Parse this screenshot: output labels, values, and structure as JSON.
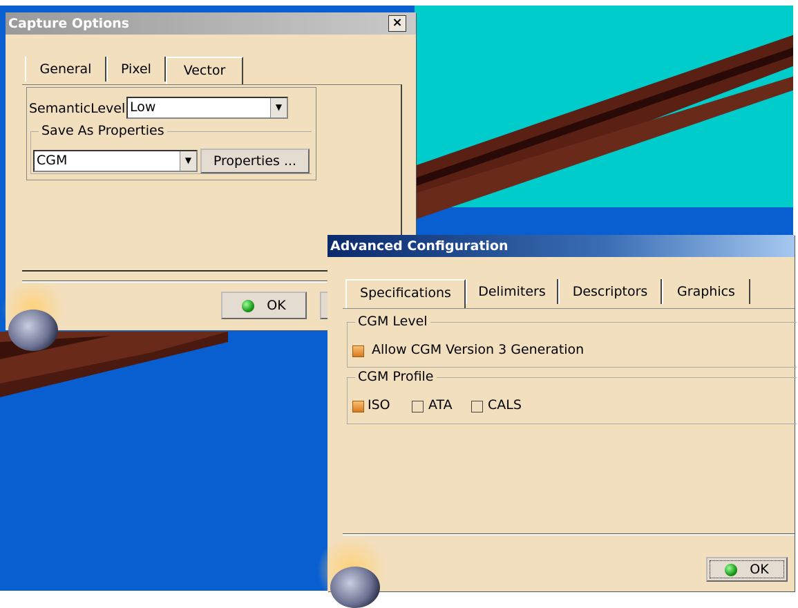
{
  "capture_dialog": {
    "title": "Capture Options",
    "close_label": "×",
    "tabs": [
      "General",
      "Pixel",
      "Vector"
    ],
    "semantic_level_label": "SemanticLevel",
    "semantic_level_value": "Low",
    "save_as_group": "Save As Properties",
    "format_value": "CGM",
    "properties_button": "Properties ...",
    "ok_label": "OK"
  },
  "advanced_dialog": {
    "title": "Advanced Configuration",
    "tabs": [
      "Specifications",
      "Delimiters",
      "Descriptors",
      "Graphics"
    ],
    "cgm_level_group": "CGM Level",
    "allow_v3_label": "Allow CGM Version 3 Generation",
    "allow_v3_checked": true,
    "cgm_profile_group": "CGM Profile",
    "profile_options": [
      {
        "label": "ISO",
        "checked": true
      },
      {
        "label": "ATA",
        "checked": false
      },
      {
        "label": "CALS",
        "checked": false
      }
    ],
    "ok_label": "OK"
  },
  "colors": {
    "dialog_bg": "#f2dfbe",
    "viewport_blue": "#0a5fd0",
    "viewport_cyan": "#00cccc",
    "part_brown": "#6a2a1a",
    "check_orange": "#e08a30"
  },
  "icons": [
    "close-icon",
    "dropdown-arrow-icon",
    "ok-green-dot-icon"
  ]
}
